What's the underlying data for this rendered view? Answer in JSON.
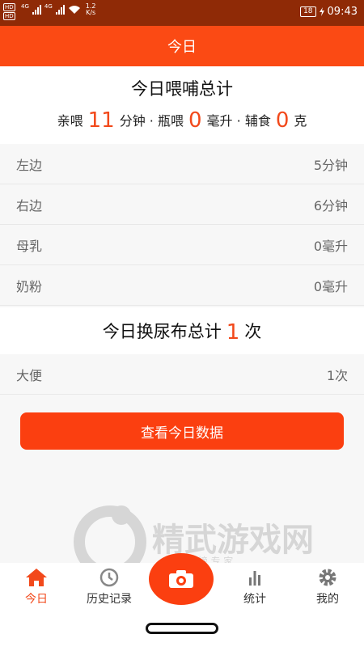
{
  "status": {
    "hd1": "HD",
    "hd2": "HD",
    "net1": "4G",
    "net2": "4G",
    "speed_value": "1.2",
    "speed_unit": "K/s",
    "battery": "18",
    "time": "09:43"
  },
  "header": {
    "title": "今日"
  },
  "summary": {
    "title": "今日喂哺总计",
    "breast_label": "亲喂",
    "breast_value": "11",
    "breast_unit": "分钟",
    "sep1": "·",
    "bottle_label": "瓶喂",
    "bottle_value": "0",
    "bottle_unit": "毫升",
    "sep2": "·",
    "food_label": "辅食",
    "food_value": "0",
    "food_unit": "克"
  },
  "feeding_rows": [
    {
      "label": "左边",
      "value": "5分钟"
    },
    {
      "label": "右边",
      "value": "6分钟"
    },
    {
      "label": "母乳",
      "value": "0毫升"
    },
    {
      "label": "奶粉",
      "value": "0毫升"
    }
  ],
  "diaper": {
    "title_prefix": "今日换尿布总计",
    "count": "1",
    "unit": "次",
    "rows": [
      {
        "label": "大便",
        "value": "1次"
      }
    ]
  },
  "main_button": {
    "label": "查看今日数据"
  },
  "watermark": {
    "name": "精武游戏网",
    "slogan": "排 行 榜 专 家"
  },
  "nav": {
    "today": "今日",
    "history": "历史记录",
    "stats": "统计",
    "mine": "我的"
  },
  "colors": {
    "accent": "#fb4a14",
    "status_bar": "#8f2a06"
  }
}
